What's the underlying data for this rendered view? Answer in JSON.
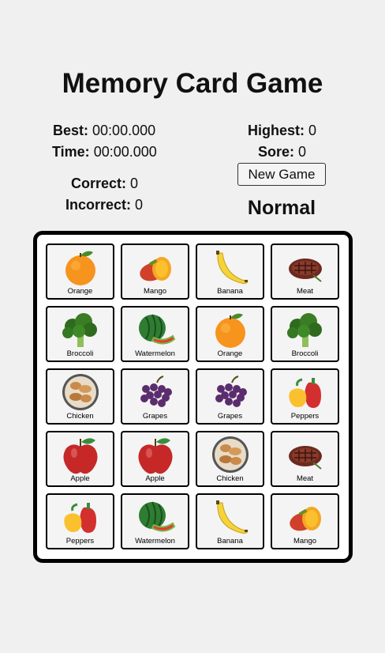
{
  "title": "Memory Card Game",
  "stats": {
    "best_label": "Best:",
    "best_value": "00:00.000",
    "time_label": "Time:",
    "time_value": "00:00.000",
    "highest_label": "Highest:",
    "highest_value": "0",
    "score_label": "Sore:",
    "score_value": "0",
    "correct_label": "Correct:",
    "correct_value": "0",
    "incorrect_label": "Incorrect:",
    "incorrect_value": "0"
  },
  "new_game_label": "New Game",
  "difficulty": "Normal",
  "cards": [
    {
      "label": "Orange",
      "icon": "orange-icon"
    },
    {
      "label": "Mango",
      "icon": "mango-icon"
    },
    {
      "label": "Banana",
      "icon": "banana-icon"
    },
    {
      "label": "Meat",
      "icon": "meat-icon"
    },
    {
      "label": "Broccoli",
      "icon": "broccoli-icon"
    },
    {
      "label": "Watermelon",
      "icon": "watermelon-icon"
    },
    {
      "label": "Orange",
      "icon": "orange-icon"
    },
    {
      "label": "Broccoli",
      "icon": "broccoli-icon"
    },
    {
      "label": "Chicken",
      "icon": "chicken-icon"
    },
    {
      "label": "Grapes",
      "icon": "grapes-icon"
    },
    {
      "label": "Grapes",
      "icon": "grapes-icon"
    },
    {
      "label": "Peppers",
      "icon": "peppers-icon"
    },
    {
      "label": "Apple",
      "icon": "apple-icon"
    },
    {
      "label": "Apple",
      "icon": "apple-icon"
    },
    {
      "label": "Chicken",
      "icon": "chicken-icon"
    },
    {
      "label": "Meat",
      "icon": "meat-icon"
    },
    {
      "label": "Peppers",
      "icon": "peppers-icon"
    },
    {
      "label": "Watermelon",
      "icon": "watermelon-icon"
    },
    {
      "label": "Banana",
      "icon": "banana-icon"
    },
    {
      "label": "Mango",
      "icon": "mango-icon"
    }
  ]
}
